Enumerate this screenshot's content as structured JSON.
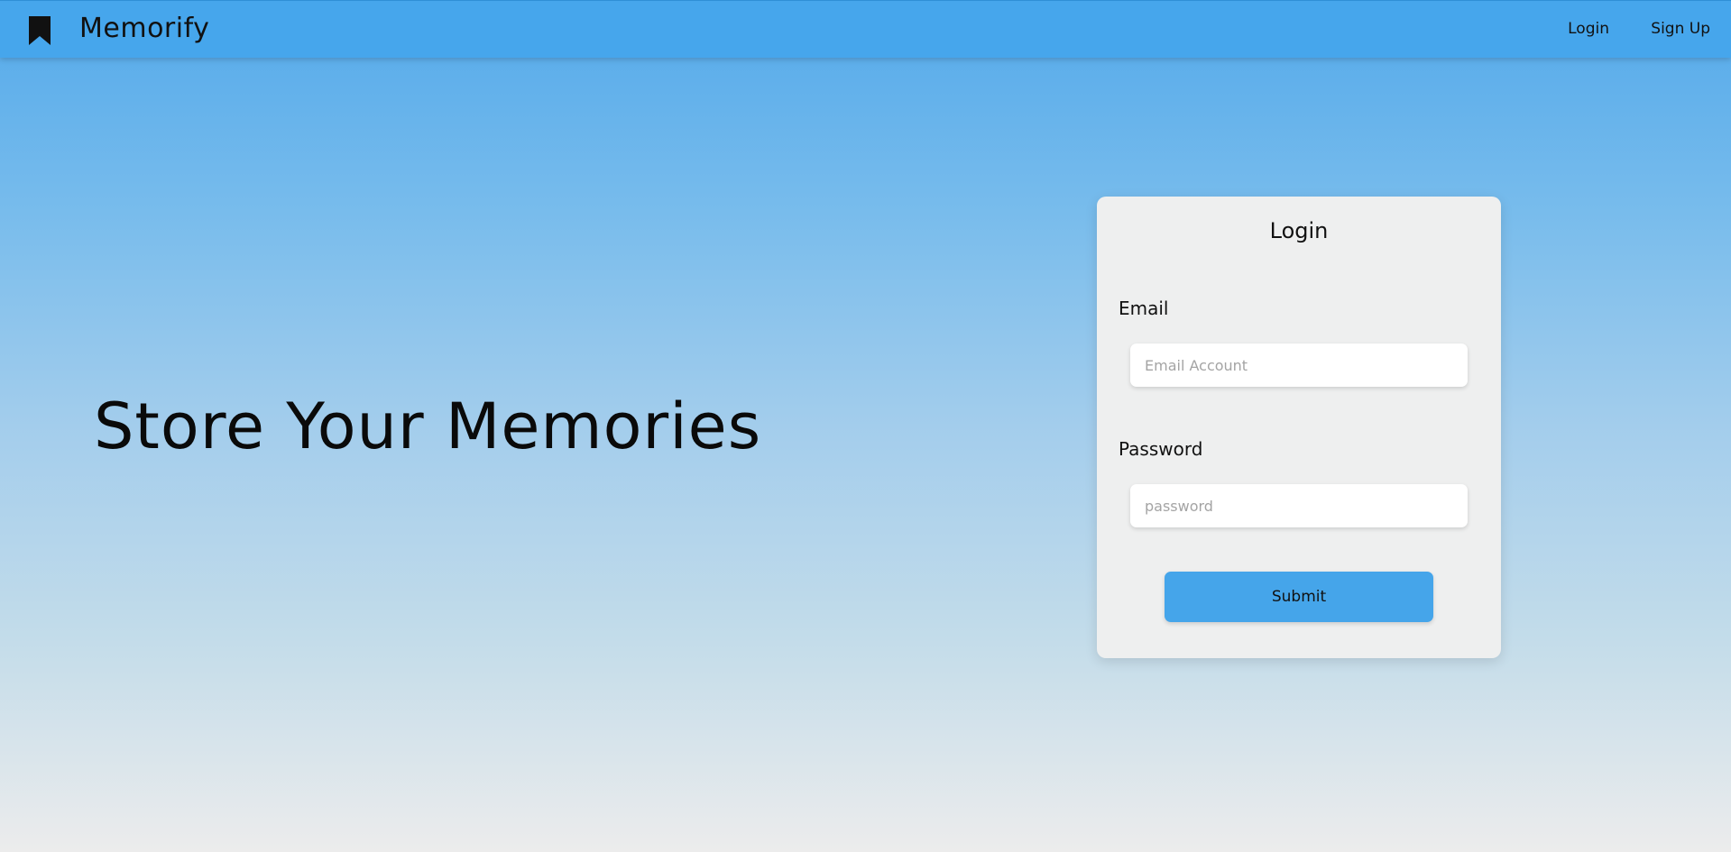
{
  "app": {
    "name": "Memorify",
    "logo_icon": "bookmark-icon"
  },
  "nav": {
    "login_label": "Login",
    "signup_label": "Sign Up"
  },
  "hero": {
    "headline": "Store Your Memories"
  },
  "login_form": {
    "title": "Login",
    "email_label": "Email",
    "email_placeholder": "Email Account",
    "email_value": "",
    "password_label": "Password",
    "password_placeholder": "password",
    "password_value": "",
    "submit_label": "Submit"
  },
  "colors": {
    "navbar": "#46a6ec",
    "accent_button": "#45a5ea",
    "card_background": "#eeefef"
  }
}
